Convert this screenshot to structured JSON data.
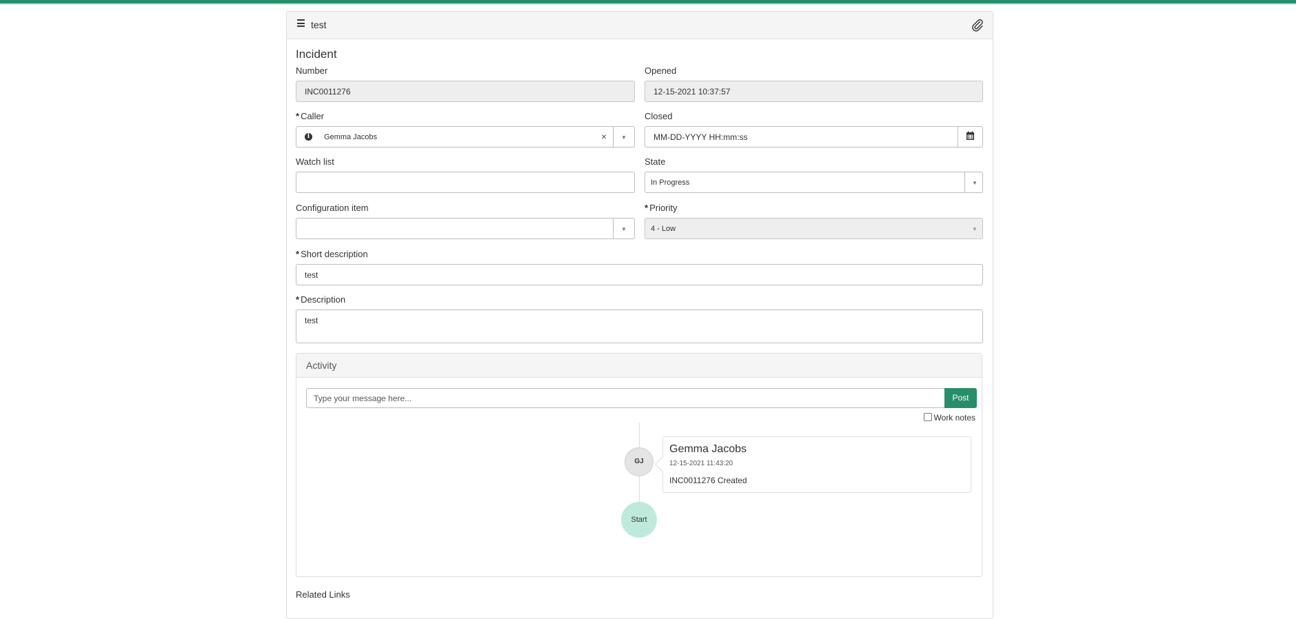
{
  "colors": {
    "brand": "#278e6a",
    "start_node": "#bfeadb"
  },
  "panel": {
    "title": "test",
    "menu_icon": "hamburger-icon",
    "attach_icon": "paperclip-icon"
  },
  "form": {
    "title": "Incident",
    "number": {
      "label": "Number",
      "value": "INC0011276"
    },
    "opened": {
      "label": "Opened",
      "value": "12-15-2021 10:37:57"
    },
    "caller": {
      "label": "Caller",
      "value": "Gemma Jacobs"
    },
    "closed": {
      "label": "Closed",
      "placeholder": "MM-DD-YYYY HH:mm:ss"
    },
    "watch_list": {
      "label": "Watch list",
      "value": ""
    },
    "state": {
      "label": "State",
      "value": "In Progress"
    },
    "configuration_item": {
      "label": "Configuration item",
      "value": ""
    },
    "priority": {
      "label": "Priority",
      "value": "4 - Low"
    },
    "short_description": {
      "label": "Short description",
      "value": "test"
    },
    "description": {
      "label": "Description",
      "value": "test"
    },
    "required_marker": "*"
  },
  "activity": {
    "title": "Activity",
    "placeholder": "Type your message here...",
    "post_label": "Post",
    "work_notes_label": "Work notes",
    "entries": [
      {
        "initials": "GJ",
        "author": "Gemma Jacobs",
        "time": "12-15-2021 11:43:20",
        "text": "INC0011276 Created"
      }
    ],
    "start_label": "Start"
  },
  "related_links": "Related Links"
}
